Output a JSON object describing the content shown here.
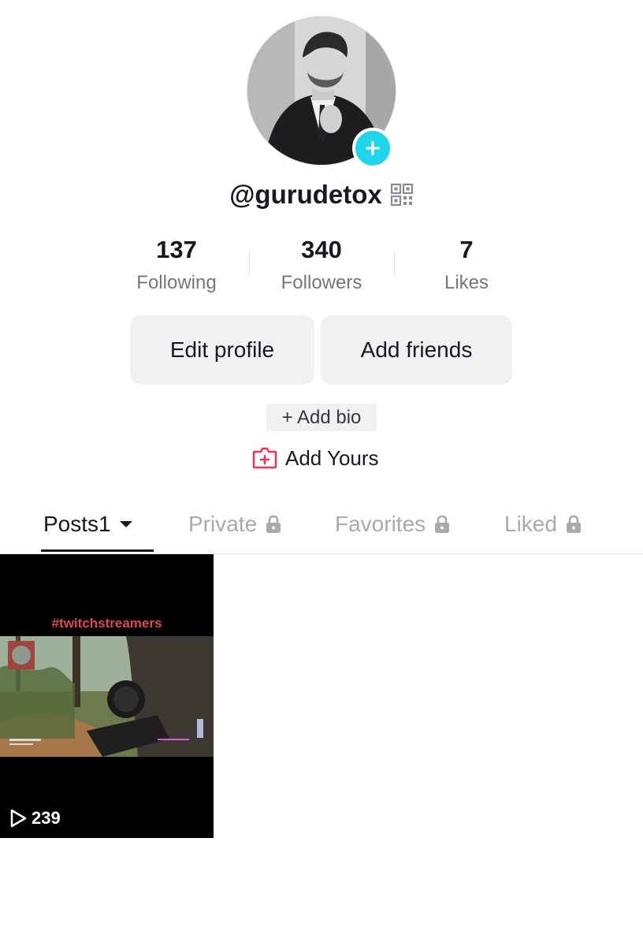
{
  "profile": {
    "username": "@gurudetox",
    "avatar_icon": "profile-photo",
    "add_icon": "plus-icon",
    "qr_icon": "qr-code-icon"
  },
  "stats": [
    {
      "value": "137",
      "label": "Following"
    },
    {
      "value": "340",
      "label": "Followers"
    },
    {
      "value": "7",
      "label": "Likes"
    }
  ],
  "buttons": {
    "edit_profile": "Edit profile",
    "add_friends": "Add friends",
    "add_bio": "+ Add bio",
    "add_yours": "Add Yours"
  },
  "tabs": [
    {
      "label": "Posts1",
      "icon": "caret-down-icon",
      "active": true
    },
    {
      "label": "Private",
      "icon": "lock-icon",
      "active": false
    },
    {
      "label": "Favorites",
      "icon": "lock-icon",
      "active": false
    },
    {
      "label": "Liked",
      "icon": "lock-icon",
      "active": false
    }
  ],
  "posts": [
    {
      "hashtag": "#twitchstreamers",
      "views": "239"
    }
  ],
  "colors": {
    "accent_cyan": "#20d5ec",
    "add_yours_red": "#fe2c55",
    "hashtag_red": "#e04848",
    "button_bg": "#f1f1f2",
    "muted_text": "#75767c"
  }
}
